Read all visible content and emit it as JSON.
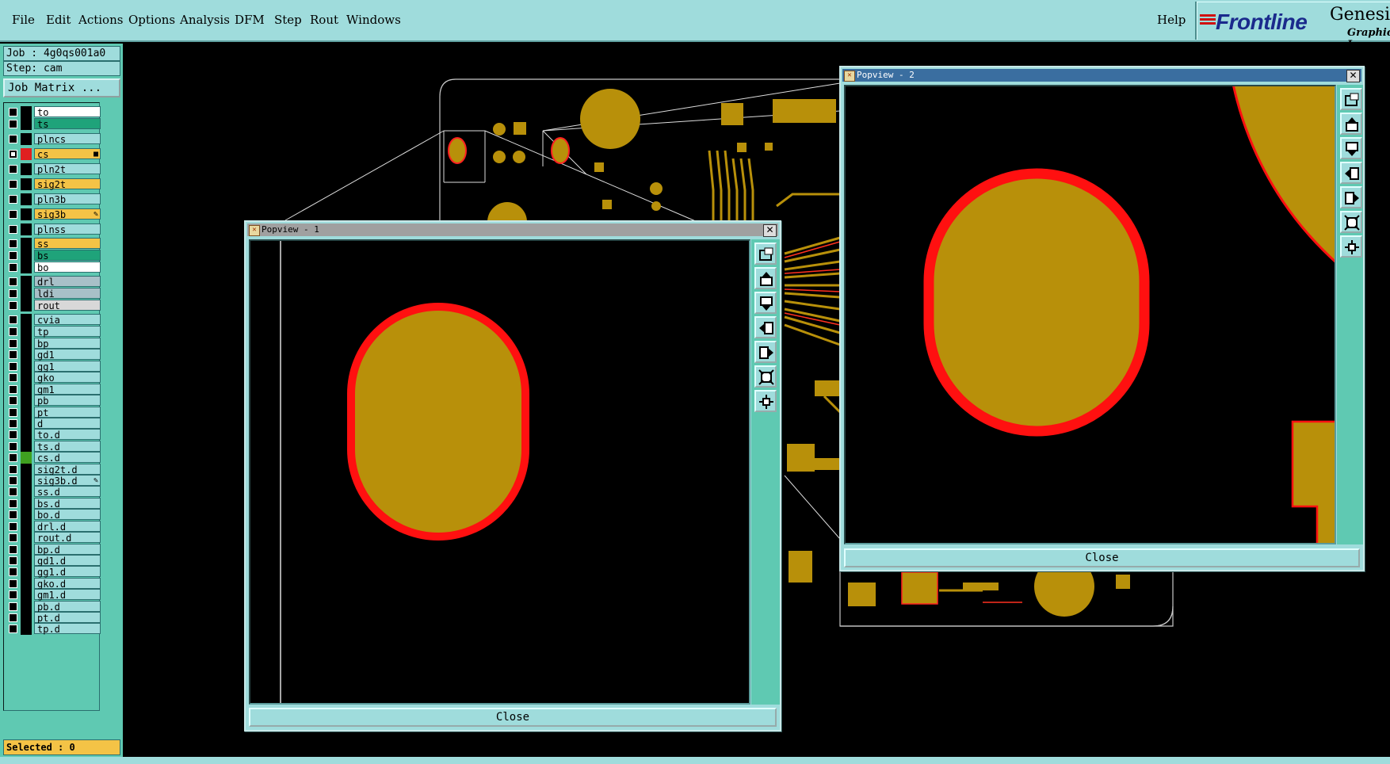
{
  "menu": [
    "File",
    "Edit",
    "Actions",
    "Options",
    "Analysis",
    "DFM",
    "Step",
    "Rout",
    "Windows"
  ],
  "help_label": "Help",
  "logo": {
    "brand": "Frontline",
    "product": "Genesis",
    "tagline": "Graphic I"
  },
  "job_label": "Job : 4g0qs001a0",
  "step_label": "Step: cam",
  "job_matrix_label": "Job Matrix ...",
  "layers": [
    {
      "name": "to",
      "color": "#ffffff",
      "swatch": "#000000"
    },
    {
      "name": "ts",
      "color": "#1fa37a",
      "swatch": "#000000"
    },
    {
      "name": "plncs",
      "color": "#9fdcdc",
      "swatch": "#000000"
    },
    {
      "name": "cs",
      "color": "#f4c346",
      "swatch": "#e02020",
      "checked": true,
      "flag": "■"
    },
    {
      "name": "pln2t",
      "color": "#9fdcdc",
      "swatch": "#000000"
    },
    {
      "name": "sig2t",
      "color": "#f4c346",
      "swatch": "#000000"
    },
    {
      "name": "pln3b",
      "color": "#9fdcdc",
      "swatch": "#000000"
    },
    {
      "name": "sig3b",
      "color": "#f4c346",
      "swatch": "#000000",
      "flag": "✎"
    },
    {
      "name": "plnss",
      "color": "#9fdcdc",
      "swatch": "#000000"
    },
    {
      "name": "ss",
      "color": "#f4c346",
      "swatch": "#000000"
    },
    {
      "name": "bs",
      "color": "#1fa37a",
      "swatch": "#000000"
    },
    {
      "name": "bo",
      "color": "#ffffff",
      "swatch": "#000000"
    },
    {
      "name": "drl",
      "color": "#a8c0c8",
      "swatch": "#000000"
    },
    {
      "name": "ldi",
      "color": "#a8c0c8",
      "swatch": "#000000"
    },
    {
      "name": "rout",
      "color": "#d8d8d8",
      "swatch": "#000000"
    },
    {
      "name": "cvia",
      "color": "#9fdcdc",
      "swatch": "#000000"
    },
    {
      "name": "tp",
      "color": "#9fdcdc",
      "swatch": "#000000"
    },
    {
      "name": "bp",
      "color": "#9fdcdc",
      "swatch": "#000000"
    },
    {
      "name": "gd1",
      "color": "#9fdcdc",
      "swatch": "#000000"
    },
    {
      "name": "gg1",
      "color": "#9fdcdc",
      "swatch": "#000000"
    },
    {
      "name": "gko",
      "color": "#9fdcdc",
      "swatch": "#000000"
    },
    {
      "name": "gm1",
      "color": "#9fdcdc",
      "swatch": "#000000"
    },
    {
      "name": "pb",
      "color": "#9fdcdc",
      "swatch": "#000000"
    },
    {
      "name": "pt",
      "color": "#9fdcdc",
      "swatch": "#000000"
    },
    {
      "name": "d",
      "color": "#9fdcdc",
      "swatch": "#000000"
    },
    {
      "name": "to.d",
      "color": "#9fdcdc",
      "swatch": "#000000"
    },
    {
      "name": "ts.d",
      "color": "#9fdcdc",
      "swatch": "#000000"
    },
    {
      "name": "cs.d",
      "color": "#9fdcdc",
      "swatch": "#3fa020"
    },
    {
      "name": "sig2t.d",
      "color": "#9fdcdc",
      "swatch": "#000000"
    },
    {
      "name": "sig3b.d",
      "color": "#9fdcdc",
      "swatch": "#000000",
      "flag": "✎"
    },
    {
      "name": "ss.d",
      "color": "#9fdcdc",
      "swatch": "#000000"
    },
    {
      "name": "bs.d",
      "color": "#9fdcdc",
      "swatch": "#000000"
    },
    {
      "name": "bo.d",
      "color": "#9fdcdc",
      "swatch": "#000000"
    },
    {
      "name": "drl.d",
      "color": "#9fdcdc",
      "swatch": "#000000"
    },
    {
      "name": "rout.d",
      "color": "#9fdcdc",
      "swatch": "#000000"
    },
    {
      "name": "bp.d",
      "color": "#9fdcdc",
      "swatch": "#000000"
    },
    {
      "name": "gd1.d",
      "color": "#9fdcdc",
      "swatch": "#000000"
    },
    {
      "name": "gg1.d",
      "color": "#9fdcdc",
      "swatch": "#000000"
    },
    {
      "name": "gko.d",
      "color": "#9fdcdc",
      "swatch": "#000000"
    },
    {
      "name": "gm1.d",
      "color": "#9fdcdc",
      "swatch": "#000000"
    },
    {
      "name": "pb.d",
      "color": "#9fdcdc",
      "swatch": "#000000"
    },
    {
      "name": "pt.d",
      "color": "#9fdcdc",
      "swatch": "#000000"
    },
    {
      "name": "tp.d",
      "color": "#9fdcdc",
      "swatch": "#000000"
    }
  ],
  "selected_label": "Selected : 0",
  "popview1": {
    "title": "Popview - 1",
    "close_label": "Close"
  },
  "popview2": {
    "title": "Popview - 2",
    "close_label": "Close"
  },
  "tool_icons": [
    "zoom-window-icon",
    "pan-up-icon",
    "pan-down-icon",
    "pan-left-icon",
    "pan-right-icon",
    "zoom-out-icon",
    "zoom-in-icon"
  ],
  "colors": {
    "copper": "#b8900a",
    "pad_outline": "#ff1010",
    "panel": "#9fdcdc",
    "teal": "#5fc9b2"
  }
}
